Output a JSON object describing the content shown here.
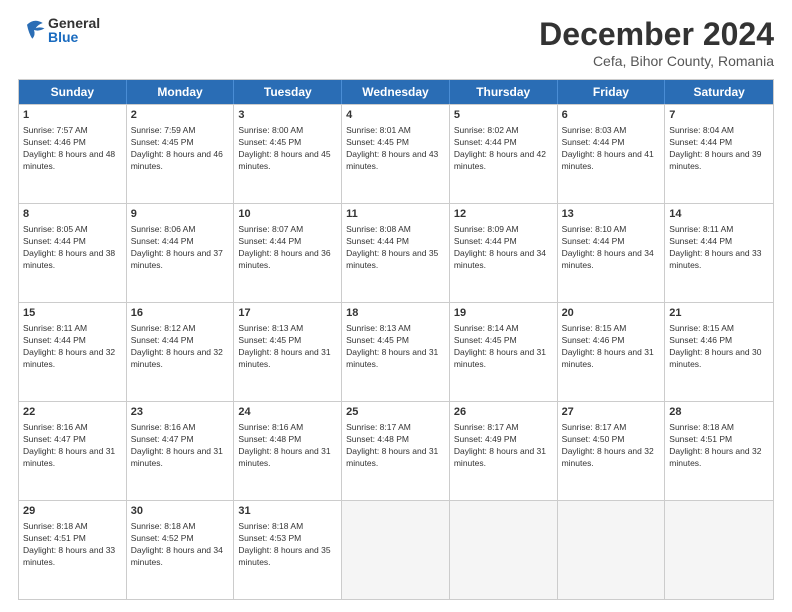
{
  "header": {
    "logo_general": "General",
    "logo_blue": "Blue",
    "main_title": "December 2024",
    "subtitle": "Cefa, Bihor County, Romania"
  },
  "calendar": {
    "days": [
      "Sunday",
      "Monday",
      "Tuesday",
      "Wednesday",
      "Thursday",
      "Friday",
      "Saturday"
    ],
    "weeks": [
      [
        {
          "day": "1",
          "sunrise": "7:57 AM",
          "sunset": "4:46 PM",
          "daylight": "8 hours and 48 minutes."
        },
        {
          "day": "2",
          "sunrise": "7:59 AM",
          "sunset": "4:45 PM",
          "daylight": "8 hours and 46 minutes."
        },
        {
          "day": "3",
          "sunrise": "8:00 AM",
          "sunset": "4:45 PM",
          "daylight": "8 hours and 45 minutes."
        },
        {
          "day": "4",
          "sunrise": "8:01 AM",
          "sunset": "4:45 PM",
          "daylight": "8 hours and 43 minutes."
        },
        {
          "day": "5",
          "sunrise": "8:02 AM",
          "sunset": "4:44 PM",
          "daylight": "8 hours and 42 minutes."
        },
        {
          "day": "6",
          "sunrise": "8:03 AM",
          "sunset": "4:44 PM",
          "daylight": "8 hours and 41 minutes."
        },
        {
          "day": "7",
          "sunrise": "8:04 AM",
          "sunset": "4:44 PM",
          "daylight": "8 hours and 39 minutes."
        }
      ],
      [
        {
          "day": "8",
          "sunrise": "8:05 AM",
          "sunset": "4:44 PM",
          "daylight": "8 hours and 38 minutes."
        },
        {
          "day": "9",
          "sunrise": "8:06 AM",
          "sunset": "4:44 PM",
          "daylight": "8 hours and 37 minutes."
        },
        {
          "day": "10",
          "sunrise": "8:07 AM",
          "sunset": "4:44 PM",
          "daylight": "8 hours and 36 minutes."
        },
        {
          "day": "11",
          "sunrise": "8:08 AM",
          "sunset": "4:44 PM",
          "daylight": "8 hours and 35 minutes."
        },
        {
          "day": "12",
          "sunrise": "8:09 AM",
          "sunset": "4:44 PM",
          "daylight": "8 hours and 34 minutes."
        },
        {
          "day": "13",
          "sunrise": "8:10 AM",
          "sunset": "4:44 PM",
          "daylight": "8 hours and 34 minutes."
        },
        {
          "day": "14",
          "sunrise": "8:11 AM",
          "sunset": "4:44 PM",
          "daylight": "8 hours and 33 minutes."
        }
      ],
      [
        {
          "day": "15",
          "sunrise": "8:11 AM",
          "sunset": "4:44 PM",
          "daylight": "8 hours and 32 minutes."
        },
        {
          "day": "16",
          "sunrise": "8:12 AM",
          "sunset": "4:44 PM",
          "daylight": "8 hours and 32 minutes."
        },
        {
          "day": "17",
          "sunrise": "8:13 AM",
          "sunset": "4:45 PM",
          "daylight": "8 hours and 31 minutes."
        },
        {
          "day": "18",
          "sunrise": "8:13 AM",
          "sunset": "4:45 PM",
          "daylight": "8 hours and 31 minutes."
        },
        {
          "day": "19",
          "sunrise": "8:14 AM",
          "sunset": "4:45 PM",
          "daylight": "8 hours and 31 minutes."
        },
        {
          "day": "20",
          "sunrise": "8:15 AM",
          "sunset": "4:46 PM",
          "daylight": "8 hours and 31 minutes."
        },
        {
          "day": "21",
          "sunrise": "8:15 AM",
          "sunset": "4:46 PM",
          "daylight": "8 hours and 30 minutes."
        }
      ],
      [
        {
          "day": "22",
          "sunrise": "8:16 AM",
          "sunset": "4:47 PM",
          "daylight": "8 hours and 31 minutes."
        },
        {
          "day": "23",
          "sunrise": "8:16 AM",
          "sunset": "4:47 PM",
          "daylight": "8 hours and 31 minutes."
        },
        {
          "day": "24",
          "sunrise": "8:16 AM",
          "sunset": "4:48 PM",
          "daylight": "8 hours and 31 minutes."
        },
        {
          "day": "25",
          "sunrise": "8:17 AM",
          "sunset": "4:48 PM",
          "daylight": "8 hours and 31 minutes."
        },
        {
          "day": "26",
          "sunrise": "8:17 AM",
          "sunset": "4:49 PM",
          "daylight": "8 hours and 31 minutes."
        },
        {
          "day": "27",
          "sunrise": "8:17 AM",
          "sunset": "4:50 PM",
          "daylight": "8 hours and 32 minutes."
        },
        {
          "day": "28",
          "sunrise": "8:18 AM",
          "sunset": "4:51 PM",
          "daylight": "8 hours and 32 minutes."
        }
      ],
      [
        {
          "day": "29",
          "sunrise": "8:18 AM",
          "sunset": "4:51 PM",
          "daylight": "8 hours and 33 minutes."
        },
        {
          "day": "30",
          "sunrise": "8:18 AM",
          "sunset": "4:52 PM",
          "daylight": "8 hours and 34 minutes."
        },
        {
          "day": "31",
          "sunrise": "8:18 AM",
          "sunset": "4:53 PM",
          "daylight": "8 hours and 35 minutes."
        },
        null,
        null,
        null,
        null
      ]
    ]
  }
}
